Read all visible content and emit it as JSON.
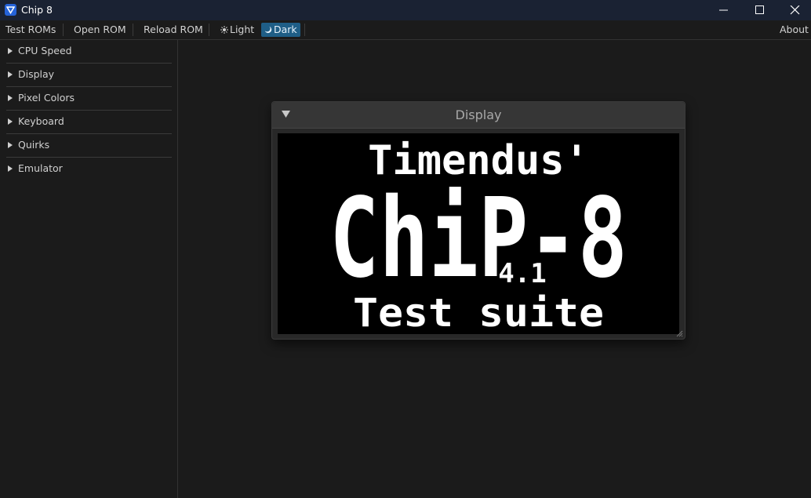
{
  "window": {
    "title": "Chip 8"
  },
  "menu": {
    "test_roms": "Test ROMs",
    "open_rom": "Open ROM",
    "reload_rom": "Reload ROM",
    "light": "Light",
    "dark": "Dark",
    "about": "About",
    "active_theme": "Dark"
  },
  "sidebar": {
    "items": [
      {
        "label": "CPU Speed"
      },
      {
        "label": "Display"
      },
      {
        "label": "Pixel Colors"
      },
      {
        "label": "Keyboard"
      },
      {
        "label": "Quirks"
      },
      {
        "label": "Emulator"
      }
    ]
  },
  "display_window": {
    "title": "Display",
    "screen": {
      "line1": "Timendus'",
      "line2": "ChiP-8",
      "version": "4.1",
      "line3": "Test suite"
    }
  },
  "icons": {
    "app": "app-logo-icon",
    "minimize": "minimize-icon",
    "maximize": "maximize-icon",
    "close": "close-icon",
    "light": "sun-icon",
    "dark": "moon-icon",
    "expand": "expand-arrow-icon",
    "collapse": "collapse-arrow-icon"
  },
  "colors": {
    "accent": "#1f5e86",
    "background": "#1b1b1b",
    "pixel_on": "#ffffff",
    "pixel_off": "#000000"
  }
}
